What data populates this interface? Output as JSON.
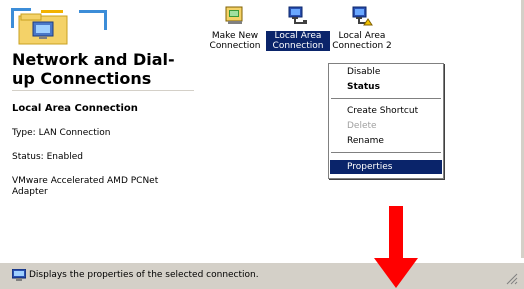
{
  "sidebar": {
    "title": "Network and Dial-up Connections",
    "details_title": "Local Area Connection",
    "type_text": "Type: LAN Connection",
    "status_text": "Status: Enabled",
    "adapter_text": "VMware Accelerated AMD PCNet Adapter"
  },
  "icons": [
    {
      "label": "Make New Connection",
      "icon": "new-connection-icon"
    },
    {
      "label": "Local Area Connection",
      "icon": "lan-connection-icon"
    },
    {
      "label": "Local Area Connection 2",
      "icon": "lan-connection-icon"
    }
  ],
  "context_menu": {
    "items": [
      {
        "label": "Disable",
        "state": "normal"
      },
      {
        "label": "Status",
        "state": "default"
      },
      {
        "label": "Create Shortcut",
        "state": "normal"
      },
      {
        "label": "Delete",
        "state": "disabled"
      },
      {
        "label": "Rename",
        "state": "normal"
      },
      {
        "label": "Properties",
        "state": "highlighted"
      }
    ]
  },
  "statusbar": {
    "text": "Displays the properties of the selected connection."
  },
  "colors": {
    "selection": "#0a246a",
    "chrome": "#d4d0c8",
    "arrow": "#ff0000"
  }
}
